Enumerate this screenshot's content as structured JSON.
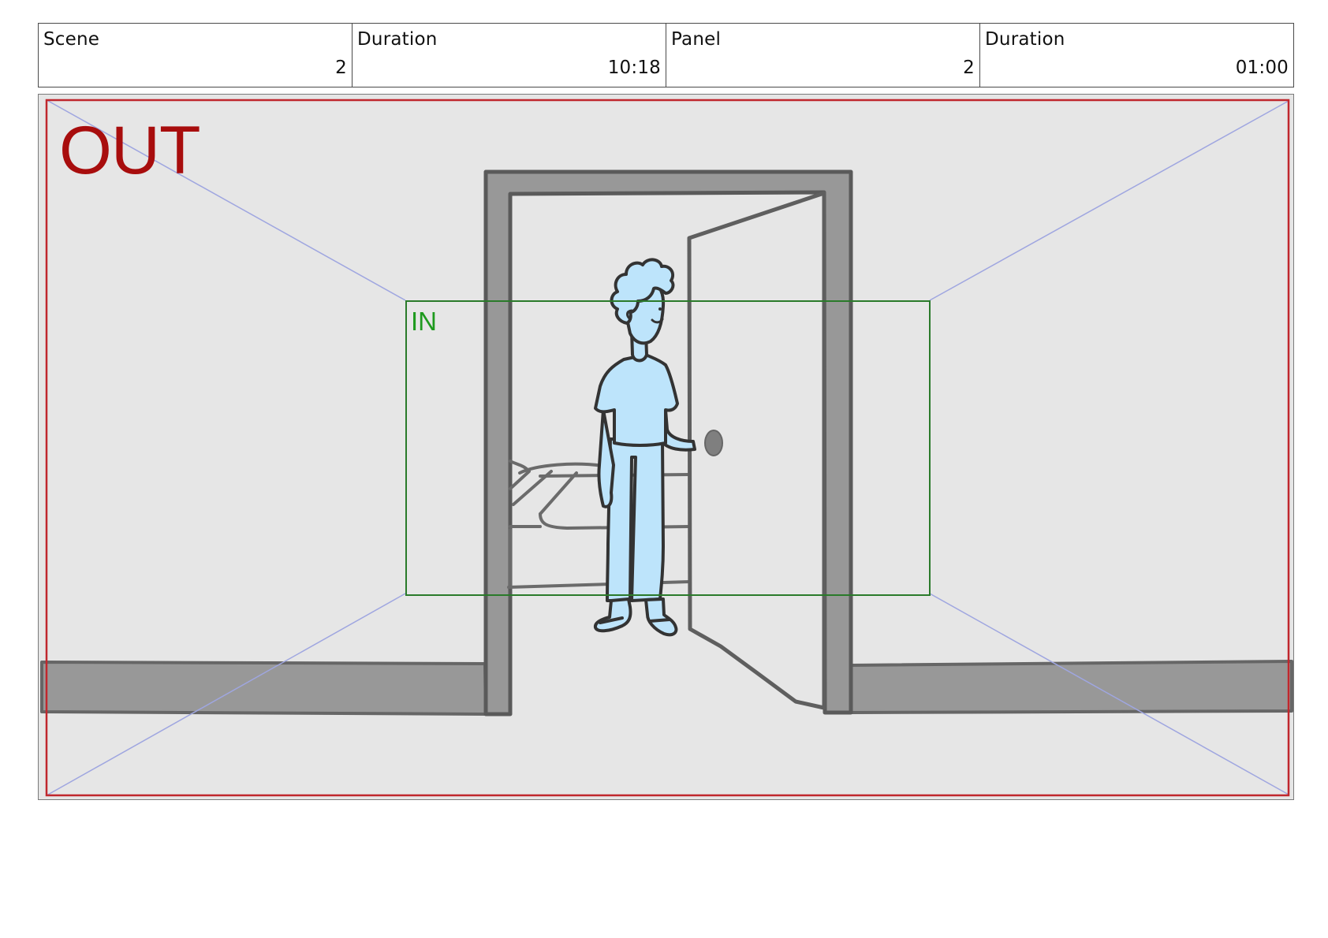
{
  "header": {
    "scene_label": "Scene",
    "scene_value": "2",
    "scene_duration_label": "Duration",
    "scene_duration_value": "10:18",
    "panel_label": "Panel",
    "panel_value": "2",
    "panel_duration_label": "Duration",
    "panel_duration_value": "01:00"
  },
  "frame": {
    "out_label": "OUT",
    "in_label": "IN"
  },
  "colors": {
    "out_frame": "#c0272d",
    "in_frame": "#2a7a2a",
    "perspective_lines": "#9fa6e0",
    "character_fill": "#bde4fb",
    "wall_trim": "#999999"
  }
}
